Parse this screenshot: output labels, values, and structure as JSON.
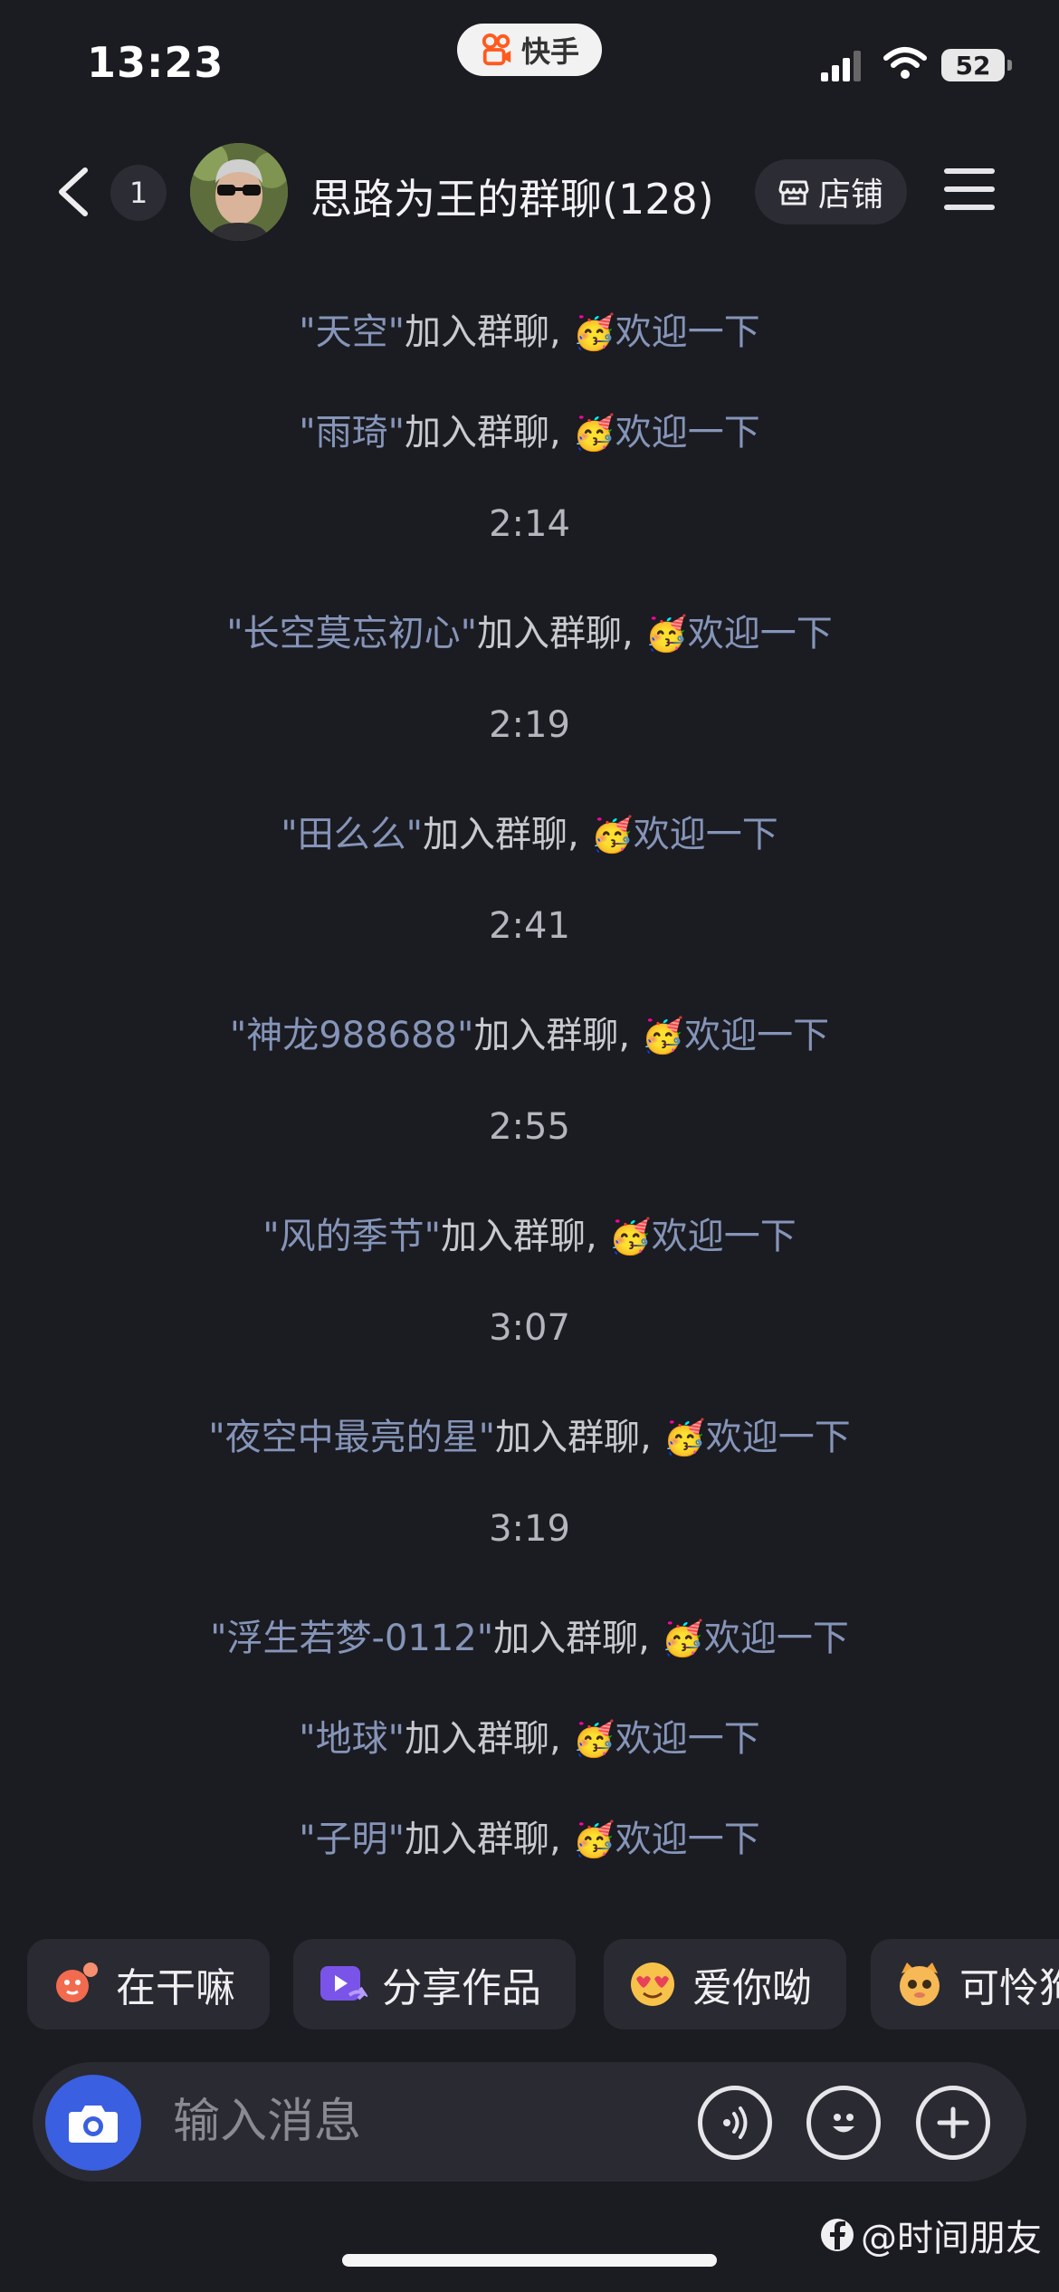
{
  "status_bar": {
    "time": "13:23",
    "app_name": "快手",
    "battery": "52"
  },
  "header": {
    "unread_count": "1",
    "title": "思路为王的群聊(128)",
    "shop_label": "店铺"
  },
  "messages": [
    {
      "type": "join",
      "name": "\"天空\"",
      "text": "加入群聊, ",
      "emoji": "🥳",
      "action": "欢迎一下"
    },
    {
      "type": "join",
      "name": "\"雨琦\"",
      "text": "加入群聊, ",
      "emoji": "🥳",
      "action": "欢迎一下"
    },
    {
      "type": "time",
      "text": "2:14"
    },
    {
      "type": "join",
      "name": "\"长空莫忘初心\"",
      "text": "加入群聊, ",
      "emoji": "🥳",
      "action": "欢迎一下"
    },
    {
      "type": "time",
      "text": "2:19"
    },
    {
      "type": "join",
      "name": "\"田么么\"",
      "text": "加入群聊, ",
      "emoji": "🥳",
      "action": "欢迎一下"
    },
    {
      "type": "time",
      "text": "2:41"
    },
    {
      "type": "join",
      "name": "\"神龙988688\"",
      "text": "加入群聊, ",
      "emoji": "🥳",
      "action": "欢迎一下"
    },
    {
      "type": "time",
      "text": "2:55"
    },
    {
      "type": "join",
      "name": "\"风的季节\"",
      "text": "加入群聊, ",
      "emoji": "🥳",
      "action": "欢迎一下"
    },
    {
      "type": "time",
      "text": "3:07"
    },
    {
      "type": "join",
      "name": "\"夜空中最亮的星\"",
      "text": "加入群聊, ",
      "emoji": "🥳",
      "action": "欢迎一下"
    },
    {
      "type": "time",
      "text": "3:19"
    },
    {
      "type": "join",
      "name": "\"浮生若梦-0112\"",
      "text": "加入群聊, ",
      "emoji": "🥳",
      "action": "欢迎一下"
    },
    {
      "type": "join",
      "name": "\"地球\"",
      "text": "加入群聊, ",
      "emoji": "🥳",
      "action": "欢迎一下"
    },
    {
      "type": "join",
      "name": "\"子明\"",
      "text": "加入群聊, ",
      "emoji": "🥳",
      "action": "欢迎一下"
    }
  ],
  "quick_replies": [
    {
      "label": "在干嘛",
      "icon": "waving-figure-icon"
    },
    {
      "label": "分享作品",
      "icon": "share-video-icon"
    },
    {
      "label": "爱你呦",
      "icon": "heart-eyes-emoji-icon"
    },
    {
      "label": "可怜狗",
      "icon": "pleading-cat-emoji-icon"
    }
  ],
  "input": {
    "placeholder": "输入消息"
  },
  "watermark": "@时间朋友",
  "colors": {
    "background": "#1b1b22",
    "name_link": "#8595b8",
    "camera_button": "#3a5fe0",
    "app_logo": "#ff5a1f"
  }
}
